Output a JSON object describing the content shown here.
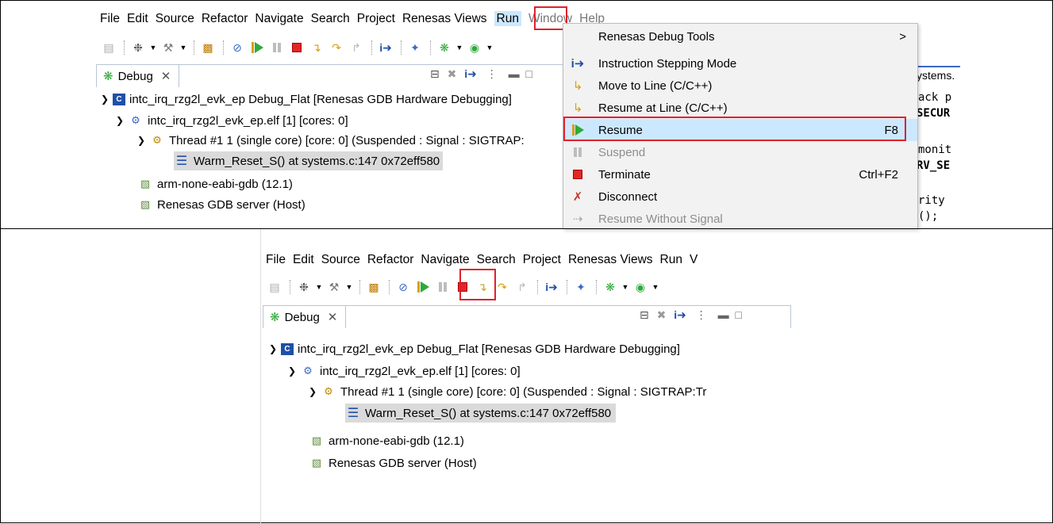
{
  "top": {
    "menubar": [
      "File",
      "Edit",
      "Source",
      "Refactor",
      "Navigate",
      "Search",
      "Project",
      "Renesas Views",
      "Run",
      "Window",
      "Help"
    ],
    "view_tab": "Debug",
    "tree": {
      "launch": "intc_irq_rzg2l_evk_ep Debug_Flat [Renesas GDB Hardware Debugging]",
      "elf": "intc_irq_rzg2l_evk_ep.elf [1] [cores: 0]",
      "thread": "Thread #1 1 (single core) [core: 0] (Suspended : Signal : SIGTRAP:",
      "frame": "Warm_Reset_S() at systems.c:147 0x72eff580",
      "gdb": "arm-none-eabi-gdb (12.1)",
      "server": "Renesas GDB server (Host)"
    },
    "run_menu": [
      {
        "label": "Renesas Debug Tools",
        "shortcut": "",
        "icon": "none",
        "submenu": true,
        "disabled": false
      },
      {
        "label": "Instruction Stepping Mode",
        "shortcut": "",
        "icon": "instruction-stepping-icon",
        "submenu": false,
        "disabled": false
      },
      {
        "label": "Move to Line (C/C++)",
        "shortcut": "",
        "icon": "move-to-line-icon",
        "submenu": false,
        "disabled": false
      },
      {
        "label": "Resume at Line (C/C++)",
        "shortcut": "",
        "icon": "resume-at-line-icon",
        "submenu": false,
        "disabled": false
      },
      {
        "label": "Resume",
        "shortcut": "F8",
        "icon": "resume-icon",
        "submenu": false,
        "disabled": false
      },
      {
        "label": "Suspend",
        "shortcut": "",
        "icon": "suspend-icon",
        "submenu": false,
        "disabled": true
      },
      {
        "label": "Terminate",
        "shortcut": "Ctrl+F2",
        "icon": "terminate-icon",
        "submenu": false,
        "disabled": false
      },
      {
        "label": "Disconnect",
        "shortcut": "",
        "icon": "disconnect-icon",
        "submenu": false,
        "disabled": false
      },
      {
        "label": "Resume Without Signal",
        "shortcut": "",
        "icon": "resume-without-signal-icon",
        "submenu": false,
        "disabled": true
      }
    ],
    "submenu_arrow": ">",
    "editor_fragments": [
      "ystems.",
      "ack p",
      "SECUR",
      "monit",
      "RV_SE",
      "rity",
      "();"
    ]
  },
  "bottom": {
    "menubar": [
      "File",
      "Edit",
      "Source",
      "Refactor",
      "Navigate",
      "Search",
      "Project",
      "Renesas Views",
      "Run",
      "V"
    ],
    "view_tab": "Debug",
    "tree": {
      "launch": "intc_irq_rzg2l_evk_ep Debug_Flat [Renesas GDB Hardware Debugging]",
      "elf": "intc_irq_rzg2l_evk_ep.elf [1] [cores: 0]",
      "thread": "Thread #1 1 (single core) [core: 0] (Suspended : Signal : SIGTRAP:Tr",
      "frame": "Warm_Reset_S() at systems.c:147 0x72eff580",
      "gdb": "arm-none-eabi-gdb (12.1)",
      "server": "Renesas GDB server (Host)"
    }
  },
  "colors": {
    "highlight_box": "#e0202c",
    "menu_highlight": "#cce8ff",
    "selection": "#dadada",
    "resume_green": "#2eaa3a"
  }
}
